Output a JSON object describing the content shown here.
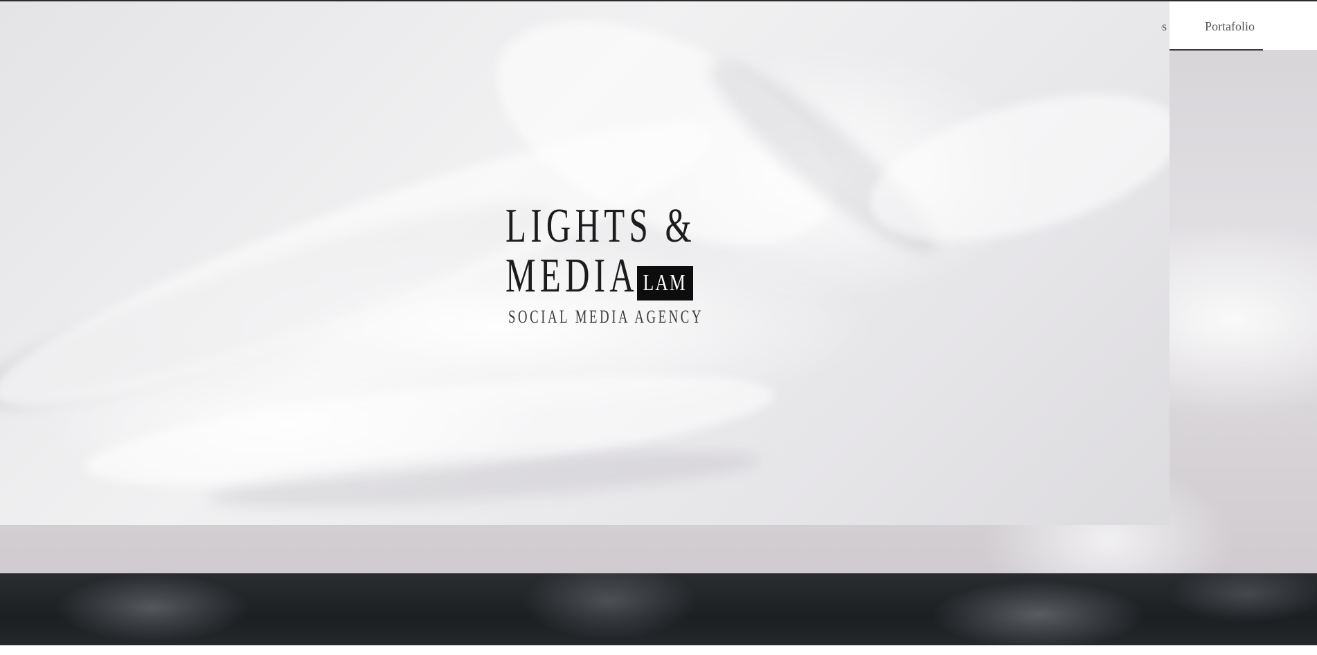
{
  "nav": {
    "partial_item": "Servicios",
    "partial_visible": "os",
    "active_item": "Portafolio"
  },
  "logo": {
    "line1": "LIGHTS &",
    "line2": "MEDIA",
    "badge": "LAM",
    "tagline": "SOCIAL MEDIA AGENCY"
  }
}
